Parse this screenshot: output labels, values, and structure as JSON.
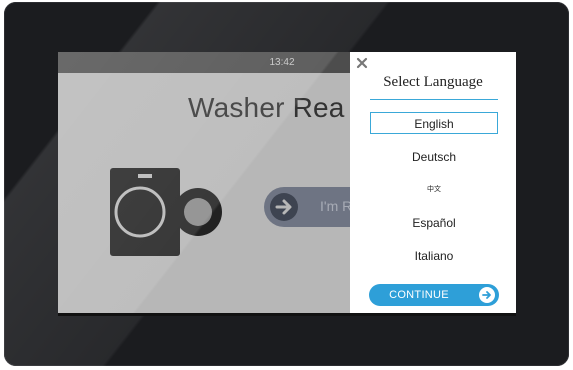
{
  "status": {
    "time": "13:42"
  },
  "background_screen": {
    "title": "Washer Rea",
    "next_button_label": "I'm R"
  },
  "language_dialog": {
    "title": "Select Language",
    "languages": [
      {
        "label": "English",
        "selected": true
      },
      {
        "label": "Deutsch",
        "selected": false
      },
      {
        "label": "中文",
        "selected": false
      },
      {
        "label": "Español",
        "selected": false
      },
      {
        "label": "Italiano",
        "selected": false
      }
    ],
    "continue_label": "CONTINUE",
    "close_icon": "close-icon"
  },
  "colors": {
    "accent": "#2e9fd8",
    "bezel": "#1b1c1f",
    "dimmed_screen": "#b7b7b7"
  }
}
